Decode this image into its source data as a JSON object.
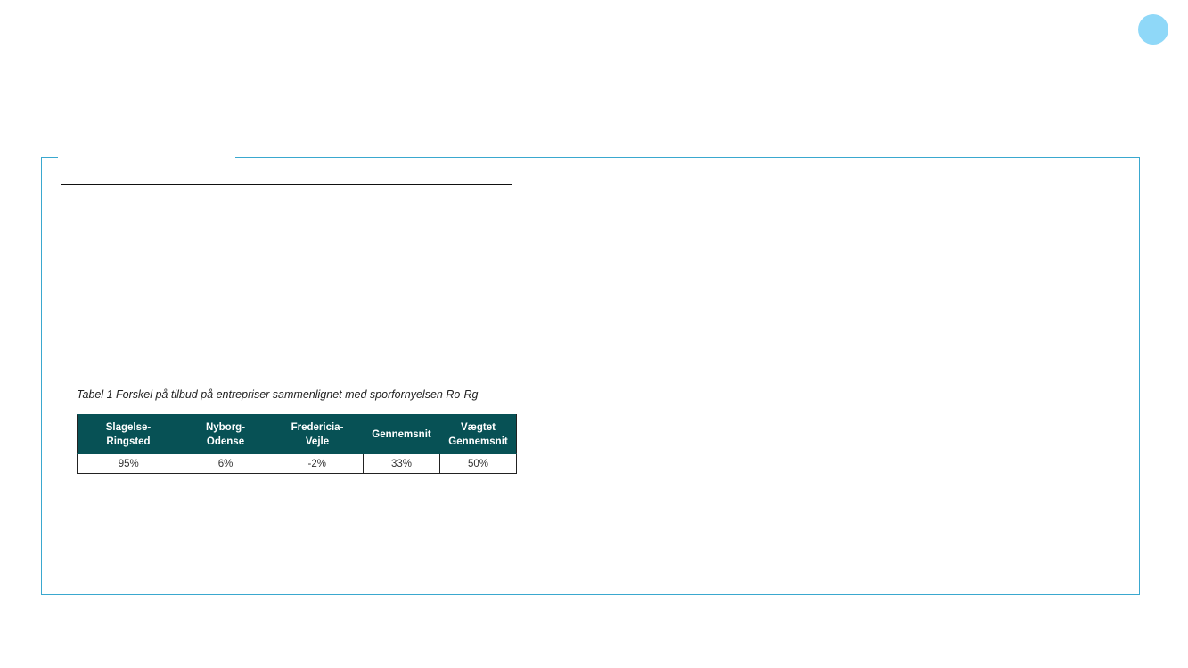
{
  "table": {
    "caption": "Tabel 1 Forskel på tilbud på entrepriser sammenlignet med sporfornyelsen Ro-Rg",
    "headers": [
      "Slagelse-\nRingsted",
      "Nyborg-\nOdense",
      "Fredericia-\nVejle",
      "Gennemsnit",
      "Vægtet\nGennemsnit"
    ],
    "rows": [
      [
        "95%",
        "6%",
        "-2%",
        "33%",
        "50%"
      ]
    ]
  },
  "colors": {
    "header_bg": "#075155",
    "frame_border": "#3aa8cf",
    "page_indicator": "#8fd8f8"
  }
}
